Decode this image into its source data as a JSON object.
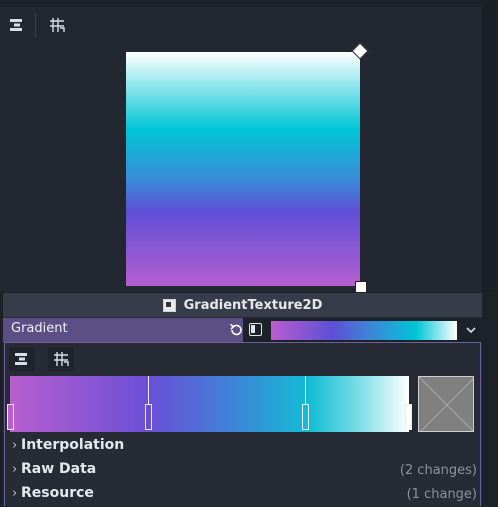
{
  "toolbar": {
    "align_icon": "align-distribute-icon",
    "grid_icon": "grid-snap-icon"
  },
  "resource": {
    "title": "GradientTexture2D",
    "icon": "texture-icon"
  },
  "property": {
    "label": "Gradient",
    "revert_icon": "revert-icon",
    "edit_icon": "edit-resource-icon",
    "dropdown_icon": "chevron-down-icon"
  },
  "gradient": {
    "stops": [
      {
        "offset": 0.0,
        "color": "#b85ed0"
      },
      {
        "offset": 0.35,
        "color": "#6a4fd6"
      },
      {
        "offset": 0.74,
        "color": "#12bcd4"
      },
      {
        "offset": 1.0,
        "color": "#ffffff"
      }
    ]
  },
  "sections": [
    {
      "label": "Interpolation",
      "changes": ""
    },
    {
      "label": "Raw Data",
      "changes": "(2 changes)"
    },
    {
      "label": "Resource",
      "changes": "(1 change)"
    }
  ],
  "colors": {
    "accent": "#5b4f86",
    "panel_bg": "#262b35",
    "header_bg": "#363c49"
  }
}
